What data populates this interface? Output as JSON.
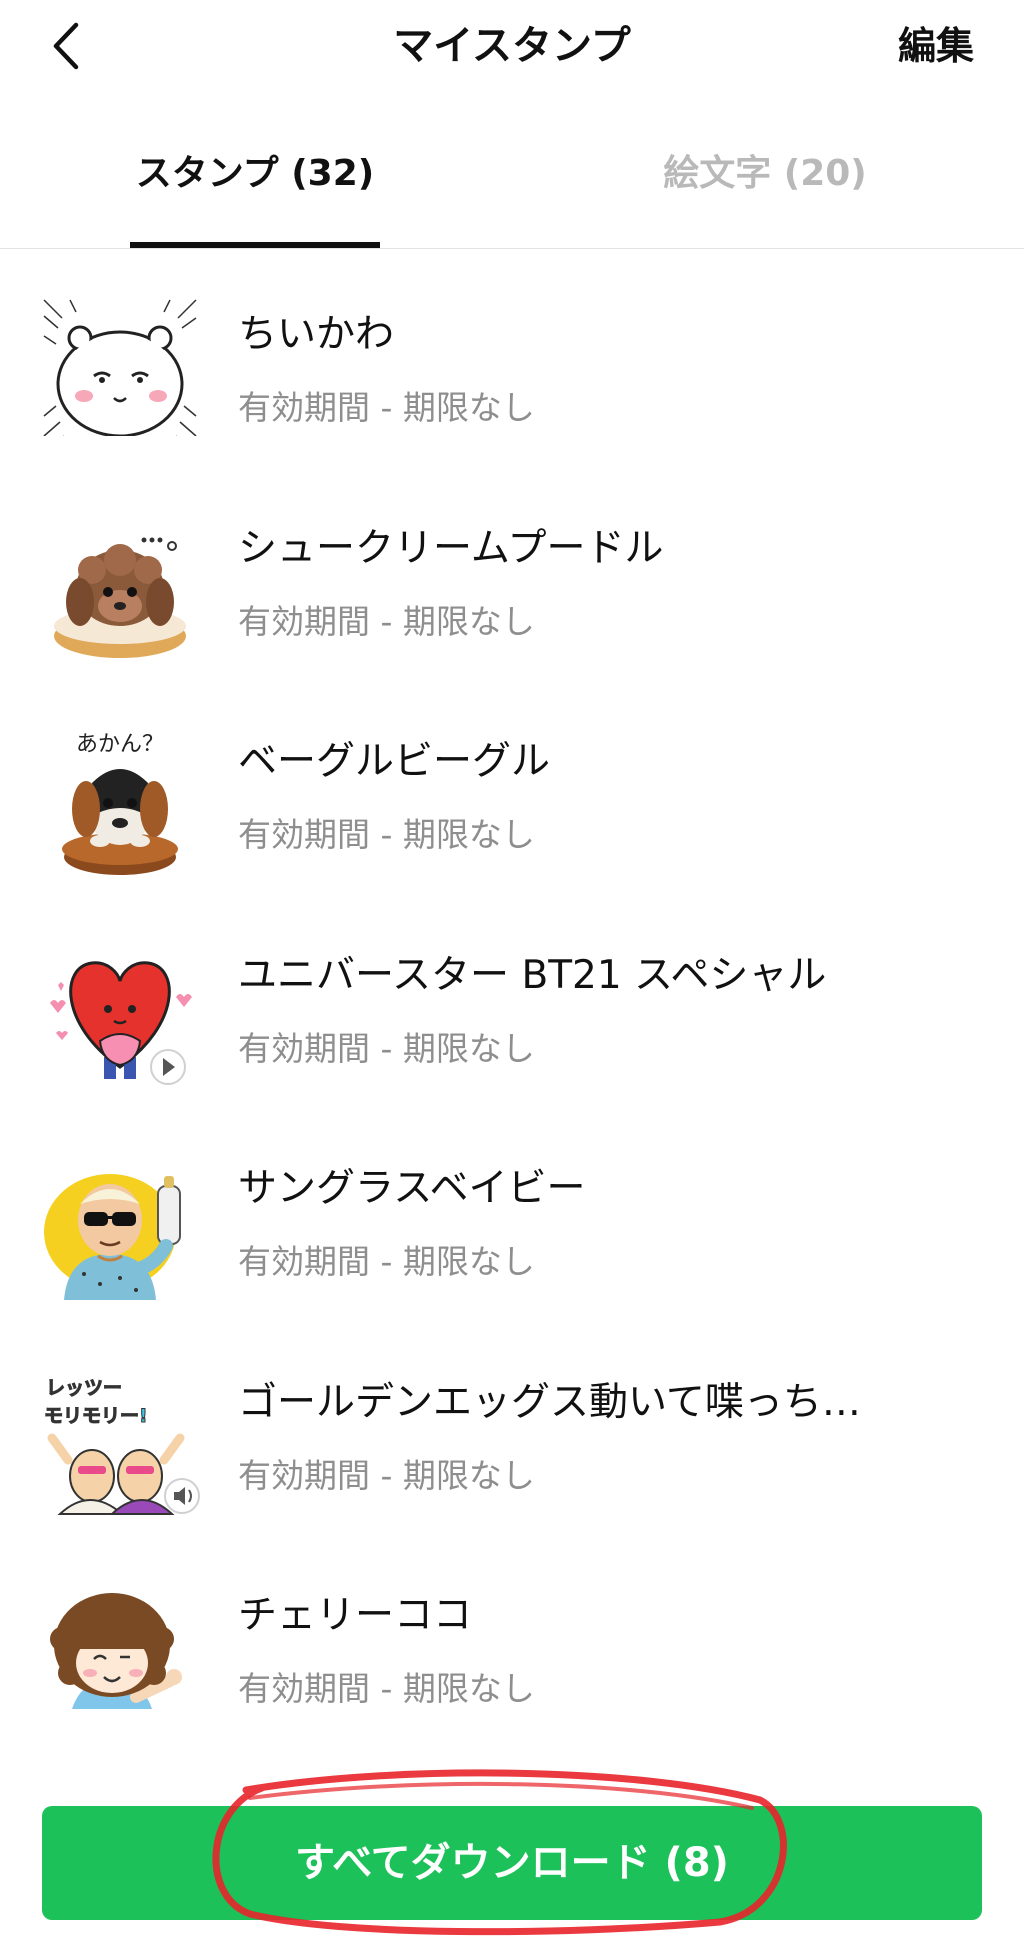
{
  "header": {
    "back_icon": "chevron-left-icon",
    "title": "マイスタンプ",
    "edit_label": "編集"
  },
  "tabs": [
    {
      "label": "スタンプ (32)",
      "active": true
    },
    {
      "label": "絵文字 (20)",
      "active": false
    }
  ],
  "items": [
    {
      "name": "ちいかわ",
      "period": "有効期間 - 期限なし",
      "thumbnail": "white-bear-character"
    },
    {
      "name": "シュークリームプードル",
      "period": "有効期間 - 期限なし",
      "thumbnail": "poodle-on-cream-puff"
    },
    {
      "name": "ベーグルビーグル",
      "period": "有効期間 - 期限なし",
      "thumbnail": "beagle-on-bagel",
      "thumbnail_text": "あかん？"
    },
    {
      "name": "ユニバースター BT21 スペシャル",
      "period": "有効期間 - 期限なし",
      "thumbnail": "red-heart-character",
      "badge_icon": "play-icon"
    },
    {
      "name": "サングラスベイビー",
      "period": "有効期間 - 期限なし",
      "thumbnail": "sunglasses-baby"
    },
    {
      "name": "ゴールデンエッグス動いて喋っち…",
      "period": "有効期間 - 期限なし",
      "thumbnail": "golden-eggs",
      "thumbnail_text": "レッツーモリモリー!",
      "badge_icon": "sound-icon"
    },
    {
      "name": "チェリーココ",
      "period": "有効期間 - 期限なし",
      "thumbnail": "cherry-coco-girl"
    }
  ],
  "download_button": {
    "label": "すべてダウンロード (8)",
    "color": "#1dc15a"
  },
  "colors": {
    "accent_green": "#1dc15a",
    "annotation_red": "#e8252b",
    "text_secondary": "#8e8e8e",
    "tab_inactive": "#b9b9b9"
  }
}
